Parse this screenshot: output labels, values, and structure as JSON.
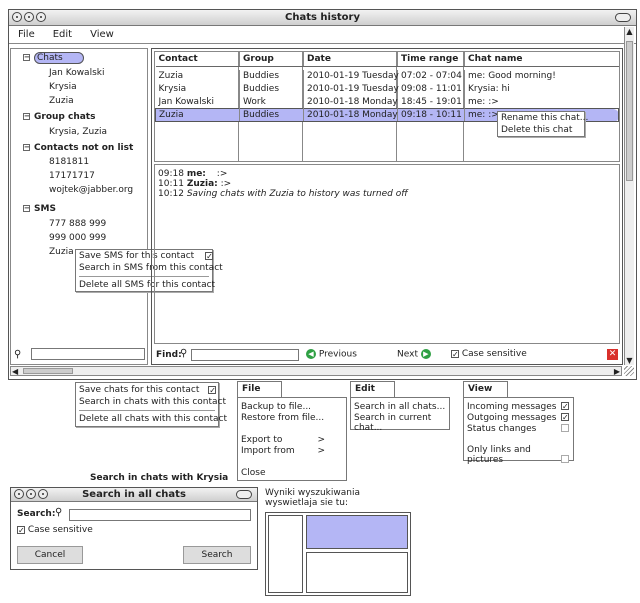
{
  "main_window": {
    "title": "Chats history",
    "menu": [
      "File",
      "Edit",
      "View"
    ]
  },
  "tree": {
    "chats_label": "Chats",
    "chats": [
      "Jan Kowalski",
      "Krysia",
      "Zuzia"
    ],
    "group_label": "Group chats",
    "groups": [
      "Krysia, Zuzia"
    ],
    "notlist_label": "Contacts not on list",
    "notlist": [
      "8181811",
      "17171717",
      "wojtek@jabber.org"
    ],
    "sms_label": "SMS",
    "sms": [
      "777 888 999",
      "999 000 999",
      "Zuzia"
    ]
  },
  "table": {
    "headers": [
      "Contact",
      "Group",
      "Date",
      "Time range",
      "Chat name"
    ],
    "rows": [
      [
        "Zuzia",
        "Buddies",
        "2010-01-19 Tuesday",
        "07:02 - 07:04",
        "me: Good morning!"
      ],
      [
        "Krysia",
        "Buddies",
        "2010-01-19 Tuesday",
        "09:08 - 11:01",
        "Krysia: hi"
      ],
      [
        "Jan Kowalski",
        "Work",
        "2010-01-18 Monday",
        "18:45 - 19:01",
        "me: :>"
      ],
      [
        "Zuzia",
        "Buddies",
        "2010-01-18 Monday",
        "09:18 - 10:11",
        "me: :>"
      ]
    ]
  },
  "row_menu": [
    "Rename this chat...",
    "Delete this chat"
  ],
  "log": [
    {
      "time": "09:18",
      "who": "me:",
      "text": ":>"
    },
    {
      "time": "10:11",
      "who": "Zuzia:",
      "text": ":>"
    },
    {
      "time": "10:12",
      "who": "",
      "text": "Saving chats with Zuzia to history was turned off"
    }
  ],
  "sms_menu": {
    "save": "Save SMS for this contact",
    "search": "Search in SMS from this contact",
    "delete": "Delete all SMS for this contact"
  },
  "findbar": {
    "label": "Find:",
    "previous": "Previous",
    "next": "Next",
    "case": "Case sensitive"
  },
  "chat_menu": {
    "save": "Save chats for this contact",
    "search": "Search in chats with this contact",
    "delete": "Delete all chats with this contact"
  },
  "file_menu": {
    "tab": "File",
    "backup": "Backup to file...",
    "restore": "Restore from file...",
    "export": "Export to",
    "import": "Import from",
    "arrow": ">",
    "close": "Close"
  },
  "edit_menu": {
    "tab": "Edit",
    "all": "Search in all chats...",
    "current": "Search in current chat..."
  },
  "view_menu": {
    "tab": "View",
    "incoming": "Incoming messages",
    "outgoing": "Outgoing messages",
    "status": "Status changes",
    "links": "Only links and pictures"
  },
  "search_caption": "Search in chats with Krysia",
  "search_dialog": {
    "title": "Search in all chats",
    "label": "Search:",
    "case": "Case sensitive",
    "cancel": "Cancel",
    "search": "Search"
  },
  "results_note": {
    "line1": "Wyniki wyszukiwania",
    "line2": "wyswietlaja sie tu:"
  },
  "colors": {
    "selection": "#b4b6f5",
    "green": "#2ea043",
    "red": "#d9302b"
  }
}
